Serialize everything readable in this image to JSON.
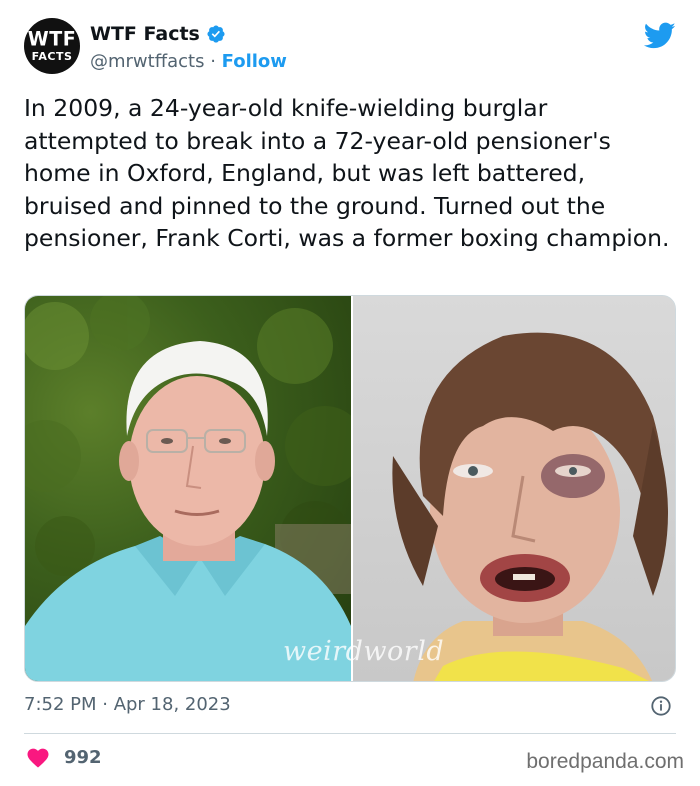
{
  "account": {
    "avatar_line1": "WTF",
    "avatar_line2": "FACTS",
    "display_name": "WTF Facts",
    "handle": "@mrwtffacts",
    "separator": " · ",
    "follow_label": "Follow",
    "verified_color": "#1d9bf0"
  },
  "brand": {
    "icon": "twitter-bird-icon",
    "color": "#1d9bf0"
  },
  "tweet": {
    "text": "In 2009, a 24-year-old knife-wielding burglar attempted to break into a 72-year-old pensioner's home in Oxford, England, but was left battered, bruised and pinned to the ground. Turned out the pensioner, Frank Corti, was a former boxing champion."
  },
  "media": {
    "watermark": "weirdworld"
  },
  "meta": {
    "timestamp": "7:52 PM · Apr 18, 2023",
    "info_icon": "info-icon"
  },
  "engagement": {
    "likes": "992",
    "heart_color": "#f91880"
  },
  "source": {
    "label": "boredpanda.com"
  }
}
